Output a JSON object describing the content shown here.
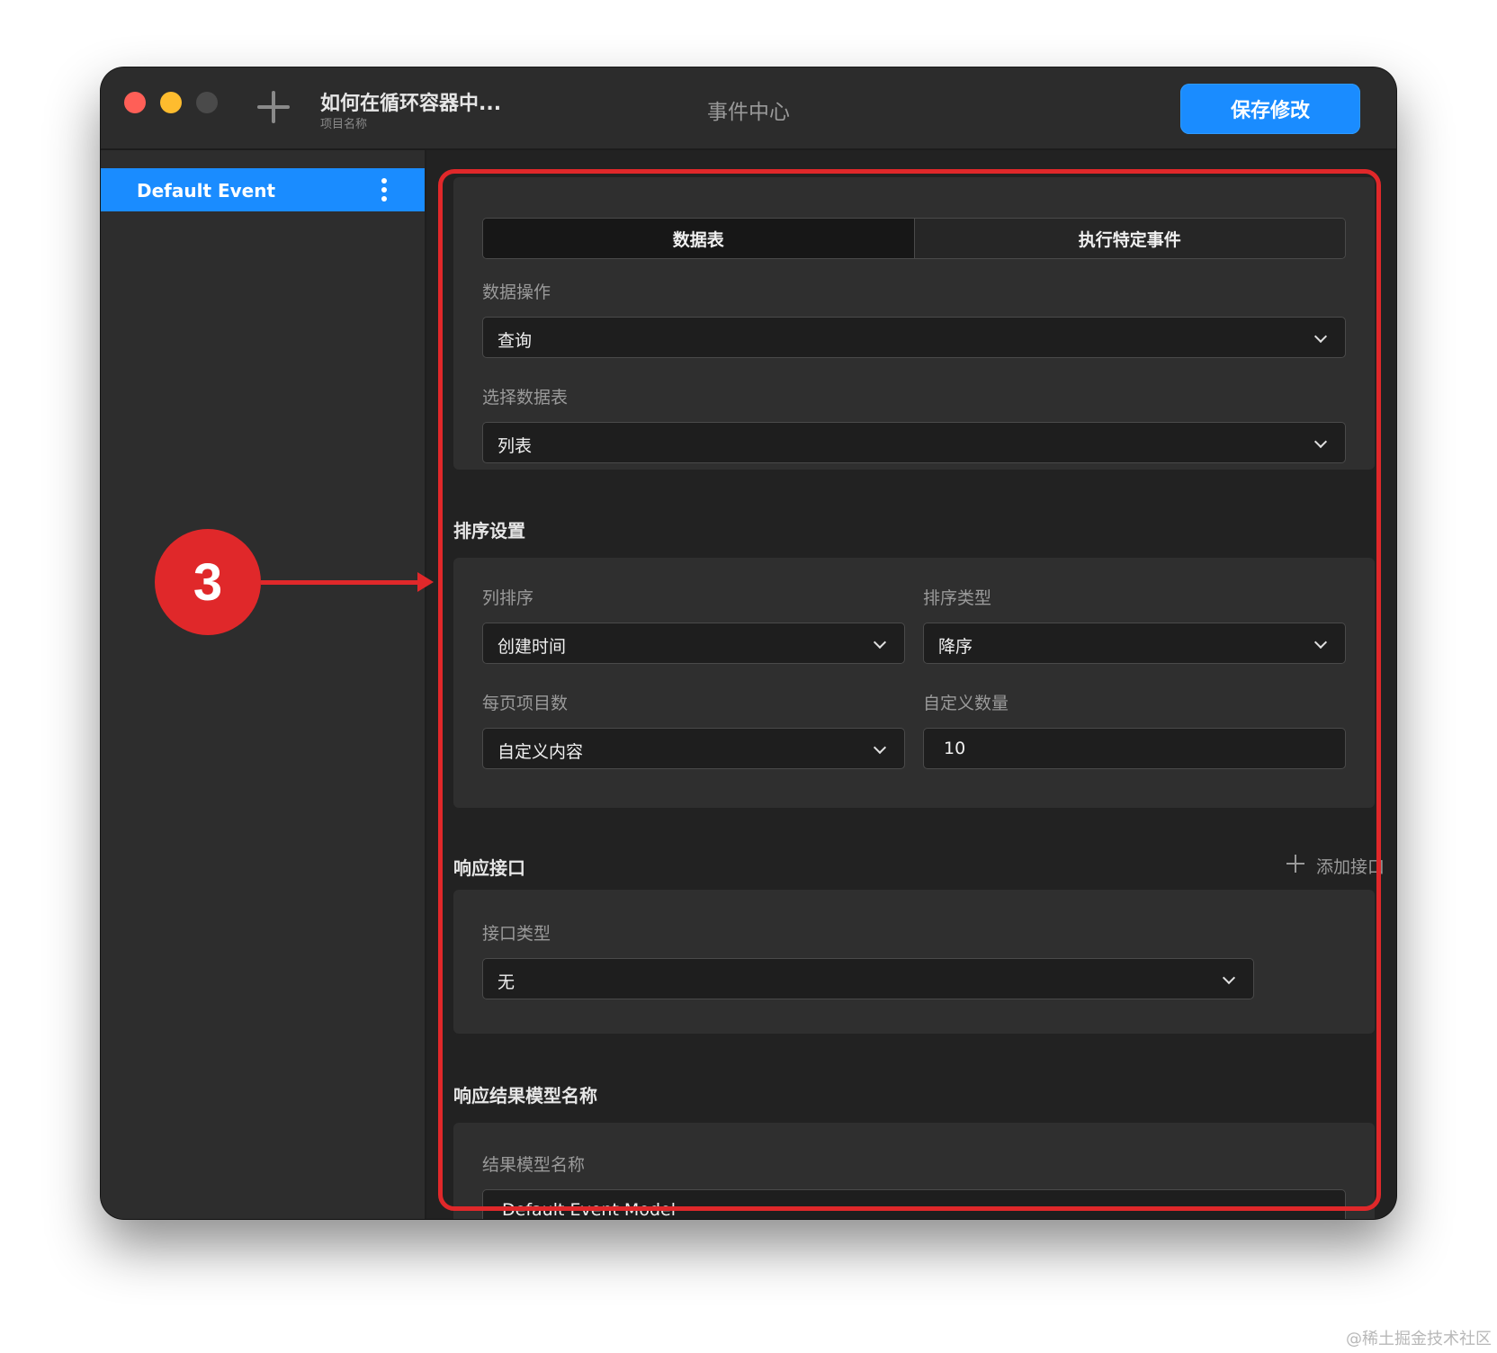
{
  "titlebar": {
    "project_title": "如何在循环容器中...",
    "project_subtitle": "项目名称",
    "center_title": "事件中心",
    "save_label": "保存修改"
  },
  "sidebar": {
    "items": [
      {
        "label": "Default Event",
        "selected": true
      }
    ]
  },
  "tabs": [
    {
      "label": "数据表",
      "active": true
    },
    {
      "label": "执行特定事件",
      "active": false
    }
  ],
  "data_ops": {
    "operation_label": "数据操作",
    "operation_value": "查询",
    "table_label": "选择数据表",
    "table_value": "列表"
  },
  "sort": {
    "section_title": "排序设置",
    "column_label": "列排序",
    "column_value": "创建时间",
    "type_label": "排序类型",
    "type_value": "降序",
    "per_page_label": "每页项目数",
    "per_page_value": "自定义内容",
    "custom_count_label": "自定义数量",
    "custom_count_value": "10"
  },
  "response": {
    "section_title": "响应接口",
    "add_label": "添加接口",
    "type_label": "接口类型",
    "type_value": "无"
  },
  "result_model": {
    "section_title": "响应结果模型名称",
    "name_label": "结果模型名称",
    "name_value": "Default Event Model"
  },
  "annotation": {
    "badge_number": "3",
    "color": "#e0282a"
  },
  "watermark": "@稀土掘金技术社区",
  "colors": {
    "accent": "#1a8cff",
    "close": "#ff5f57",
    "minimize": "#febc2e"
  }
}
